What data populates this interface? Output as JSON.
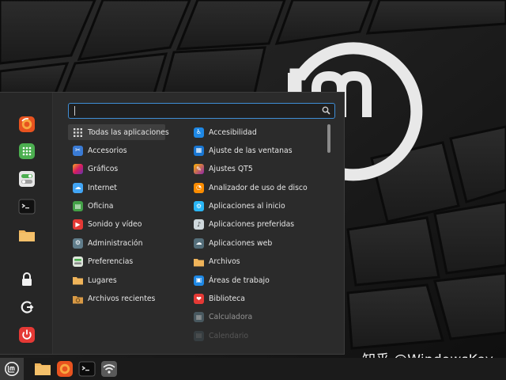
{
  "search": {
    "value": "",
    "placeholder": ""
  },
  "favorites": [
    {
      "name": "firefox",
      "icon": "firefox-icon"
    },
    {
      "name": "software-manager",
      "icon": "grid-dots-icon"
    },
    {
      "name": "settings",
      "icon": "toggle-settings-icon"
    },
    {
      "name": "terminal",
      "icon": "terminal-icon"
    },
    {
      "name": "files",
      "icon": "folder-icon"
    },
    {
      "name": "lock-screen",
      "icon": "lock-icon"
    },
    {
      "name": "logout",
      "icon": "logout-icon"
    },
    {
      "name": "shutdown",
      "icon": "power-icon"
    }
  ],
  "categories": [
    {
      "label": "Todas las aplicaciones",
      "icon": "grid-dots-icon",
      "selected": true
    },
    {
      "label": "Accesorios",
      "icon": "scissors-icon",
      "color": "#3a7bd5"
    },
    {
      "label": "Gráficos",
      "icon": "graphics-icon",
      "color": "#c2185b"
    },
    {
      "label": "Internet",
      "icon": "cloud-icon",
      "color": "#42a5f5"
    },
    {
      "label": "Oficina",
      "icon": "office-icon",
      "color": "#43a047"
    },
    {
      "label": "Sonido y vídeo",
      "icon": "play-icon",
      "color": "#e53935"
    },
    {
      "label": "Administración",
      "icon": "admin-icon",
      "color": "#607d8b"
    },
    {
      "label": "Preferencias",
      "icon": "preferences-icon",
      "color": "#8bc34a"
    },
    {
      "label": "Lugares",
      "icon": "folder-icon",
      "color": "#f0b45a"
    },
    {
      "label": "Archivos recientes",
      "icon": "recent-folder-icon",
      "color": "#e0a652"
    }
  ],
  "apps": [
    {
      "label": "Accesibilidad",
      "icon": "accessibility-icon",
      "color": "#1e88e5"
    },
    {
      "label": "Ajuste de las ventanas",
      "icon": "window-tiling-icon",
      "color": "#1976d2"
    },
    {
      "label": "Ajustes QT5",
      "icon": "qt-settings-icon",
      "color": "#8e24aa"
    },
    {
      "label": "Analizador de uso de disco",
      "icon": "disk-usage-icon",
      "color": "#fb8c00"
    },
    {
      "label": "Aplicaciones al inicio",
      "icon": "startup-apps-icon",
      "color": "#29b6f6"
    },
    {
      "label": "Aplicaciones preferidas",
      "icon": "preferred-apps-icon",
      "color": "#cfd8dc"
    },
    {
      "label": "Aplicaciones web",
      "icon": "web-apps-icon",
      "color": "#546e7a"
    },
    {
      "label": "Archivos",
      "icon": "folder-icon",
      "color": "#f0b45a"
    },
    {
      "label": "Áreas de trabajo",
      "icon": "workspaces-icon",
      "color": "#1e88e5"
    },
    {
      "label": "Biblioteca",
      "icon": "library-icon",
      "color": "#e53935"
    },
    {
      "label": "Calculadora",
      "icon": "calculator-icon",
      "color": "#607d8b"
    },
    {
      "label": "Calendario",
      "icon": "calendar-icon",
      "color": "#607d8b"
    }
  ],
  "panel": [
    {
      "name": "menu-button",
      "icon": "linux-mint-icon"
    },
    {
      "name": "files-launcher",
      "icon": "folder-icon"
    },
    {
      "name": "firefox-launcher",
      "icon": "firefox-icon"
    },
    {
      "name": "terminal-launcher",
      "icon": "terminal-icon"
    },
    {
      "name": "network-applet",
      "icon": "wifi-icon"
    }
  ],
  "watermark": {
    "text": "知乎 @WindowsKey"
  },
  "colors": {
    "accent": "#3f8ed6",
    "menu_bg": "#2b2b2b",
    "panel_bg": "#1b1b1b"
  }
}
